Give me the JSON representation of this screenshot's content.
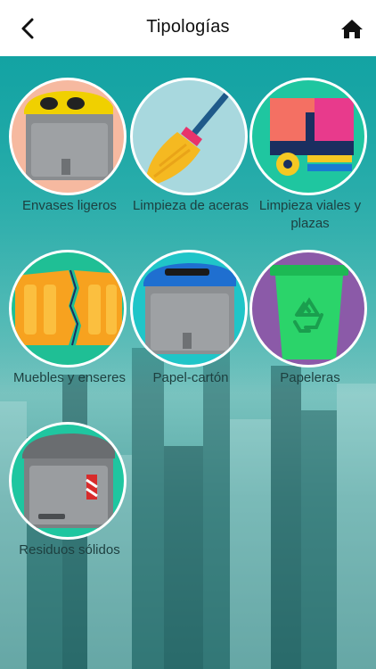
{
  "header": {
    "title": "Tipologías",
    "back_icon": "chevron-left-icon",
    "home_icon": "home-icon"
  },
  "colors": {
    "header_bg": "#ffffff",
    "teal": "#13a3a3",
    "circle_envases": "#f6b9a0",
    "circle_aceras": "#a8d8de",
    "circle_viales": "#1fc6a0",
    "circle_muebles": "#1fbf95",
    "circle_papel": "#20c5c8",
    "circle_papeleras": "#8b5aa8",
    "circle_residuos": "#1fc6a0"
  },
  "categories": [
    {
      "label": "Envases ligeros",
      "icon": "yellow-lid-container-icon"
    },
    {
      "label": "Limpieza de aceras",
      "icon": "broom-icon"
    },
    {
      "label": "Limpieza viales y plazas",
      "icon": "street-sweeper-icon"
    },
    {
      "label": "Muebles y enseres",
      "icon": "broken-furniture-icon"
    },
    {
      "label": "Papel-cartón",
      "icon": "blue-lid-container-icon"
    },
    {
      "label": "Papeleras",
      "icon": "recycling-bin-icon"
    },
    {
      "label": "Residuos sólidos",
      "icon": "grey-lid-container-icon"
    }
  ]
}
